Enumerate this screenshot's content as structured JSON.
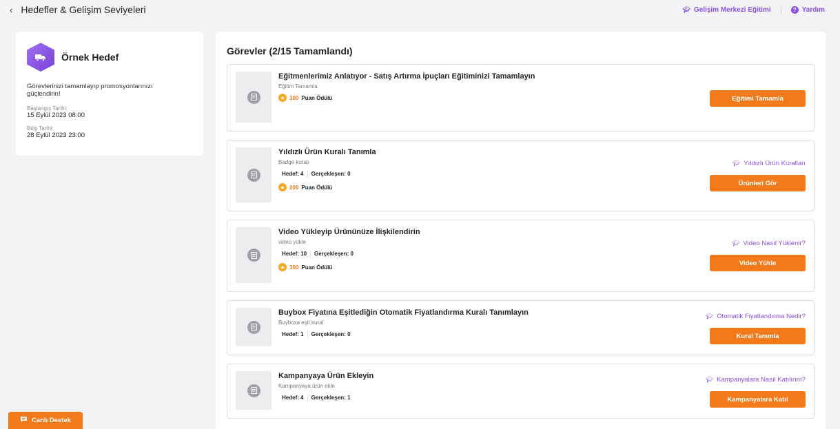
{
  "header": {
    "back_glyph": "‹",
    "title": "Hedefler & Gelişim Seviyeleri",
    "training_link": "Gelişim Merkezi Eğitimi",
    "help_link": "Yardım"
  },
  "goal": {
    "title": "Örnek Hedef",
    "description": "Görevlerinizi tamamlayıp promosyonlarınızı güçlendirin!",
    "start_label": "Başlangıç Tarihi:",
    "start_value": "15 Eylül 2023 08:00",
    "end_label": "Bitiş Tarihi:",
    "end_value": "28 Eylül 2023 23:00"
  },
  "tasks_title": "Görevler (2/15 Tamamlandı)",
  "tasks": [
    {
      "title": "Eğitmenlerimiz Anlatıyor - Satış Artırma İpuçları Eğitiminizi Tamamlayın",
      "subtitle": "Eğitim Tamamla",
      "reward_points": "100",
      "reward_suffix": "Puan Ödülü",
      "button": "Eğitimi Tamamla"
    },
    {
      "title": "Yıldızlı Ürün Kuralı Tanımla",
      "subtitle": "Badge kuralı",
      "target_label": "Hedef:",
      "target_value": "4",
      "actual_label": "Gerçekleşen:",
      "actual_value": "0",
      "reward_points": "200",
      "reward_suffix": "Puan Ödülü",
      "link": "Yıldızlı Ürün Kuralları",
      "button": "Ürünleri Gör"
    },
    {
      "title": "Video Yükleyip Ürününüze İlişkilendirin",
      "subtitle": "video yükle",
      "target_label": "Hedef:",
      "target_value": "10",
      "actual_label": "Gerçekleşen:",
      "actual_value": "0",
      "reward_points": "300",
      "reward_suffix": "Puan Ödülü",
      "link": "Video Nasıl Yüklenir?",
      "button": "Video Yükle"
    },
    {
      "title": "Buybox Fiyatına Eşitlediğin Otomatik Fiyatlandırma Kuralı Tanımlayın",
      "subtitle": "Buyboxa eşit kural",
      "target_label": "Hedef:",
      "target_value": "1",
      "actual_label": "Gerçekleşen:",
      "actual_value": "0",
      "link": "Otomatik Fiyatlandırma Nedir?",
      "button": "Kural Tanımla"
    },
    {
      "title": "Kampanyaya Ürün Ekleyin",
      "subtitle": "Kampanyaya ürün ekle",
      "target_label": "Hedef:",
      "target_value": "4",
      "actual_label": "Gerçekleşen:",
      "actual_value": "1",
      "link": "Kampanyalara Nasıl Katılırım?",
      "button": "Kampanyalara Katıl"
    }
  ],
  "live_support": "Canlı Destek",
  "colors": {
    "accent_orange": "#f27a1a",
    "accent_purple": "#8a4fe0",
    "star": "#f5a623"
  },
  "icons": [
    "back-chevron-icon",
    "graduation-cap-icon",
    "help-icon",
    "truck-icon",
    "document-icon",
    "star-icon",
    "chat-icon"
  ]
}
